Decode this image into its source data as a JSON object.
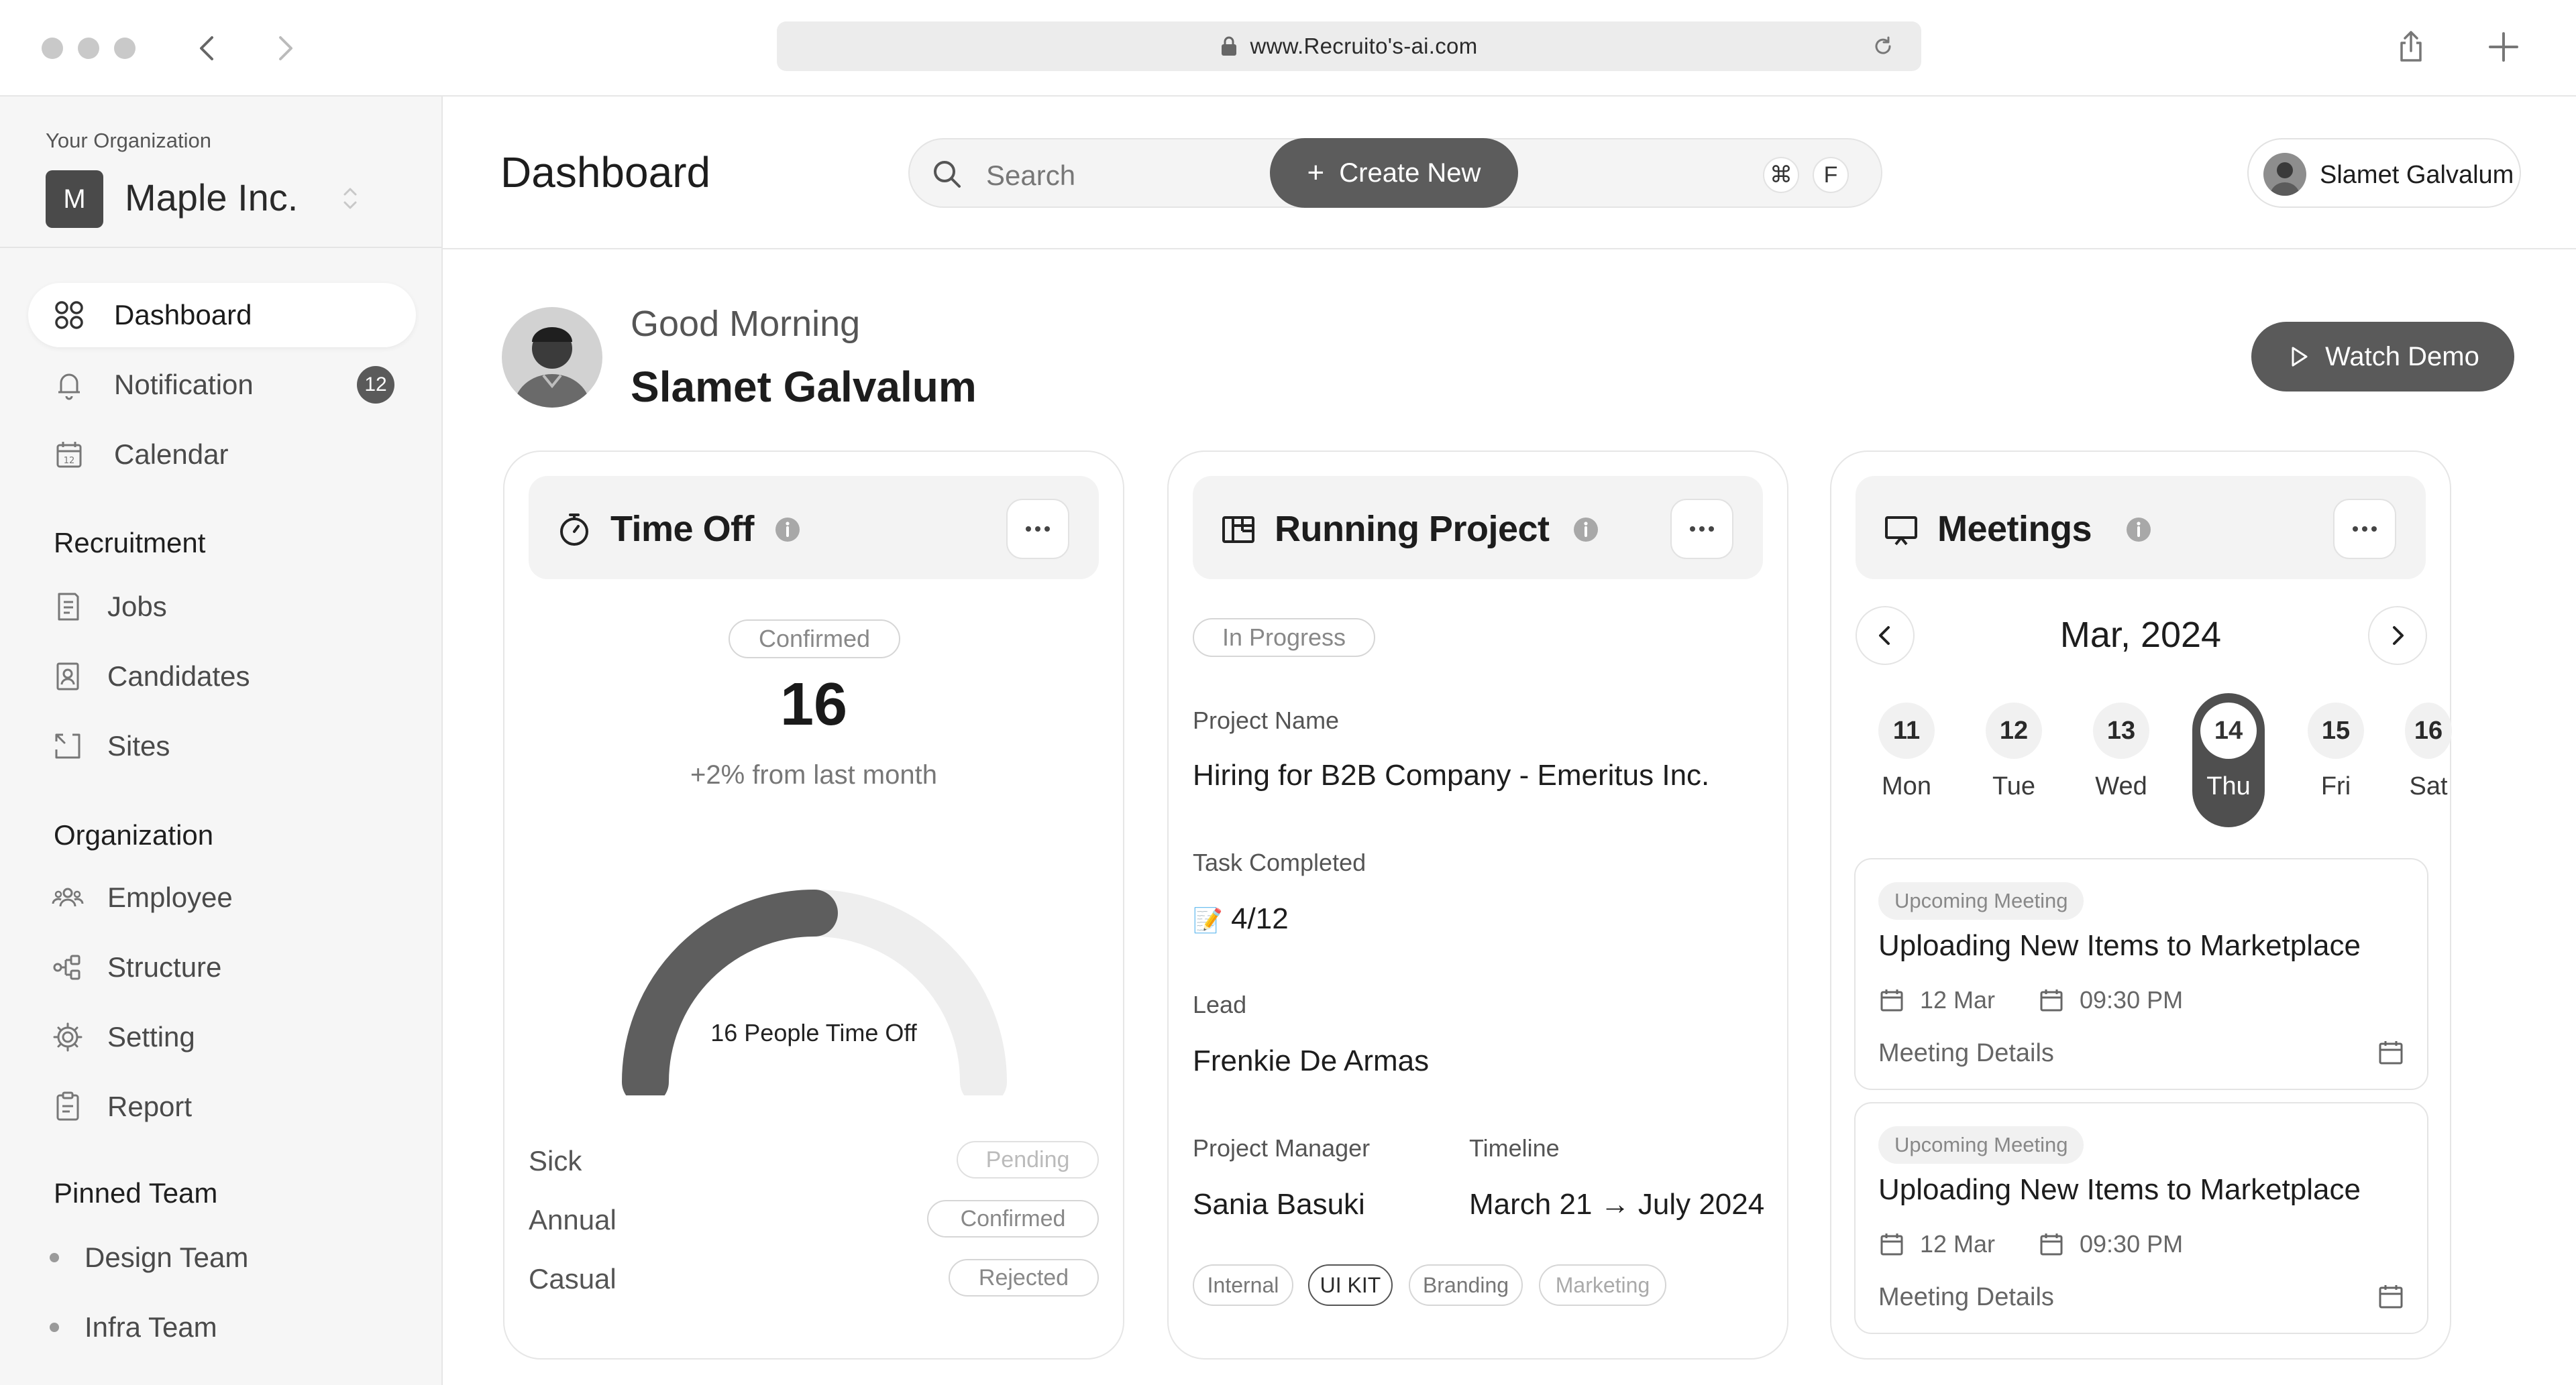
{
  "browser": {
    "url": "www.Recruito's-ai.com"
  },
  "sidebar": {
    "org_label": "Your Organization",
    "org_initial": "M",
    "org_name": "Maple Inc.",
    "main_items": [
      {
        "label": "Dashboard",
        "icon": "grid-icon",
        "active": true
      },
      {
        "label": "Notification",
        "icon": "bell-icon",
        "badge": "12"
      },
      {
        "label": "Calendar",
        "icon": "calendar-icon"
      }
    ],
    "recruitment_title": "Recruitment",
    "recruitment_items": [
      {
        "label": "Jobs",
        "icon": "document-icon"
      },
      {
        "label": "Candidates",
        "icon": "id-card-icon"
      },
      {
        "label": "Sites",
        "icon": "expand-icon"
      }
    ],
    "organization_title": "Organization",
    "organization_items": [
      {
        "label": "Employee",
        "icon": "people-icon"
      },
      {
        "label": "Structure",
        "icon": "hierarchy-icon"
      },
      {
        "label": "Setting",
        "icon": "gear-icon"
      },
      {
        "label": "Report",
        "icon": "clipboard-icon"
      }
    ],
    "pinned_title": "Pinned Team",
    "pinned_items": [
      {
        "label": "Design Team"
      },
      {
        "label": "Infra Team"
      }
    ]
  },
  "header": {
    "title": "Dashboard",
    "search_placeholder": "Search",
    "shortcut_cmd": "⌘",
    "shortcut_key": "F",
    "create_label": "Create New",
    "user_name": "Slamet Galvalum"
  },
  "greeting": {
    "hello": "Good Morning",
    "name": "Slamet Galvalum",
    "demo_label": "Watch Demo"
  },
  "time_off": {
    "title": "Time Off",
    "status": "Confirmed",
    "count": "16",
    "delta": "+2% from last month",
    "gauge_label": "16 People Time Off",
    "gauge_fraction": 0.5,
    "rows": [
      {
        "label": "Sick",
        "status": "Pending"
      },
      {
        "label": "Annual",
        "status": "Confirmed"
      },
      {
        "label": "Casual",
        "status": "Rejected"
      }
    ]
  },
  "project": {
    "title": "Running Project",
    "status": "In Progress",
    "name_label": "Project Name",
    "name_value": "Hiring for B2B Company - Emeritus Inc.",
    "task_label": "Task Completed",
    "task_icon": "📝",
    "task_value": "4/12",
    "lead_label": "Lead",
    "lead_value": "Frenkie De Armas",
    "pm_label": "Project Manager",
    "pm_value": "Sania Basuki",
    "timeline_label": "Timeline",
    "timeline_value": "March 21 → July 2024",
    "tags": [
      "Internal",
      "UI KIT",
      "Branding",
      "Marketing"
    ]
  },
  "meetings": {
    "title": "Meetings",
    "month": "Mar, 2024",
    "days": [
      {
        "num": "11",
        "name": "Mon"
      },
      {
        "num": "12",
        "name": "Tue"
      },
      {
        "num": "13",
        "name": "Wed"
      },
      {
        "num": "14",
        "name": "Thu",
        "selected": true
      },
      {
        "num": "15",
        "name": "Fri"
      },
      {
        "num": "16",
        "name": "Sat"
      }
    ],
    "items": [
      {
        "badge": "Upcoming Meeting",
        "title": "Uploading New Items to Marketplace",
        "date": "12 Mar",
        "time": "09:30 PM",
        "details": "Meeting Details"
      },
      {
        "badge": "Upcoming Meeting",
        "title": "Uploading New Items to Marketplace",
        "date": "12 Mar",
        "time": "09:30 PM",
        "details": "Meeting Details"
      }
    ]
  },
  "colors": {
    "primary_button": "#5c5c5c",
    "sidebar_bg": "#f6f6f6",
    "selected_day": "#4f4f4f"
  }
}
